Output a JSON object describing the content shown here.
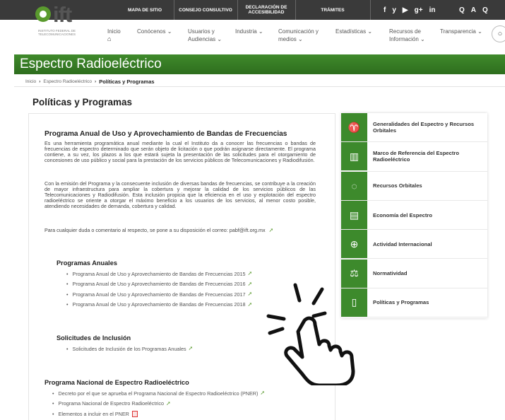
{
  "topbar": {
    "links": [
      "MAPA DE SITIO",
      "CONSEJO CONSULTIVO",
      "DECLARACIÓN DE ACCESIBILIDAD",
      "TRÁMITES"
    ],
    "social": [
      "f",
      "y",
      "▶",
      "g+",
      "in"
    ],
    "accessibility": [
      "Q",
      "A",
      "Q"
    ]
  },
  "logo": {
    "word": "ift",
    "subtitle": "INSTITUTO FEDERAL DE TELECOMUNICACIONES"
  },
  "nav": {
    "home": "Inicio",
    "items": [
      "Conócenos",
      "Usuarios y Audiencias",
      "Industria",
      "Comunicación y medios",
      "Estadísticas",
      "Recursos de Información",
      "Transparencia"
    ]
  },
  "banner": {
    "title": "Espectro Radioeléctrico"
  },
  "breadcrumb": {
    "items": [
      "Inicio",
      "Espectro Radioeléctrico"
    ],
    "current": "Políticas y Programas"
  },
  "page": {
    "title": "Políticas y Programas"
  },
  "main": {
    "heading": "Programa Anual de Uso y Aprovechamiento de Bandas de Frecuencias",
    "paragraphs": [
      "Es una herramienta programática anual mediante la cual el Instituto da a conocer las frecuencias o bandas de frecuencias de espectro determinado que serán objeto de licitación o que podrán asignarse directamente. El programa contiene, a su vez, los plazos a los que estará sujeta la presentación de las solicitudes para el otorgamiento de concesiones de uso público y social para la prestación de los servicios públicos de Telecomunicaciones y Radiodifusión.",
      "Con la emisión del Programa y la consecuente inclusión de diversas bandas de frecuencias, se contribuye a la creación de mayor infraestructura para ampliar la cobertura y mejorar la calidad de los servicios públicos de las Telecomunicaciones y Radiodifusión. Esta inclusión propicia que la eficiencia en el uso y explotación del espectro radioeléctrico se oriente a otorgar el máximo beneficio a los usuarios de los servicios, al menor costo posible, atendiendo necesidades de demanda, cobertura y calidad.",
      "Para cualquier duda o comentario al respecto, se pone a su disposición el correo: pabf@ift.org.mx"
    ],
    "anuales_heading": "Programas Anuales",
    "anuales": [
      "Programa Anual de Uso y Aprovechamiento de Bandas de Frecuencias 2015",
      "Programa Anual de Uso y Aprovechamiento de Bandas de Frecuencias 2016",
      "Programa Anual de Uso y Aprovechamiento de Bandas de Frecuencias 2017",
      "Programa Anual de Uso y Aprovechamiento de Bandas de Frecuencias 2018"
    ],
    "solicitudes_heading": "Solicitudes de Inclusión",
    "solicitudes": [
      "Solicitudes de Inclusión de los Programas Anuales"
    ],
    "nacional_heading": "Programa Nacional de Espectro Radioeléctrico",
    "nacional": [
      "Decreto por el que se aprueba el Programa Nacional de Espectro Radioeléctrico (PNER)",
      "Programa Nacional de Espectro Radioeléctrico",
      "Elementos a incluir en el PNER"
    ]
  },
  "side": {
    "items": [
      {
        "label": "Generalidades del Espectro y Recursos Orbitales",
        "icon": "satellite-dish-icon",
        "glyph": "♈"
      },
      {
        "label": "Marco de Referencia del Espectro Radioeléctrico",
        "icon": "building-icon",
        "glyph": "▥"
      },
      {
        "label": "Recursos Orbitales",
        "icon": "orbit-icon",
        "glyph": "◌"
      },
      {
        "label": "Economía del Espectro",
        "icon": "chart-icon",
        "glyph": "▤"
      },
      {
        "label": "Actividad Internacional",
        "icon": "globe-icon",
        "glyph": "⊕"
      },
      {
        "label": "Normatividad",
        "icon": "scales-icon",
        "glyph": "⚖"
      },
      {
        "label": "Políticas y Programas",
        "icon": "document-icon",
        "glyph": "▯"
      }
    ]
  },
  "colors": {
    "brand_green": "#3d8a2c",
    "topbar": "#3a3a3a"
  }
}
